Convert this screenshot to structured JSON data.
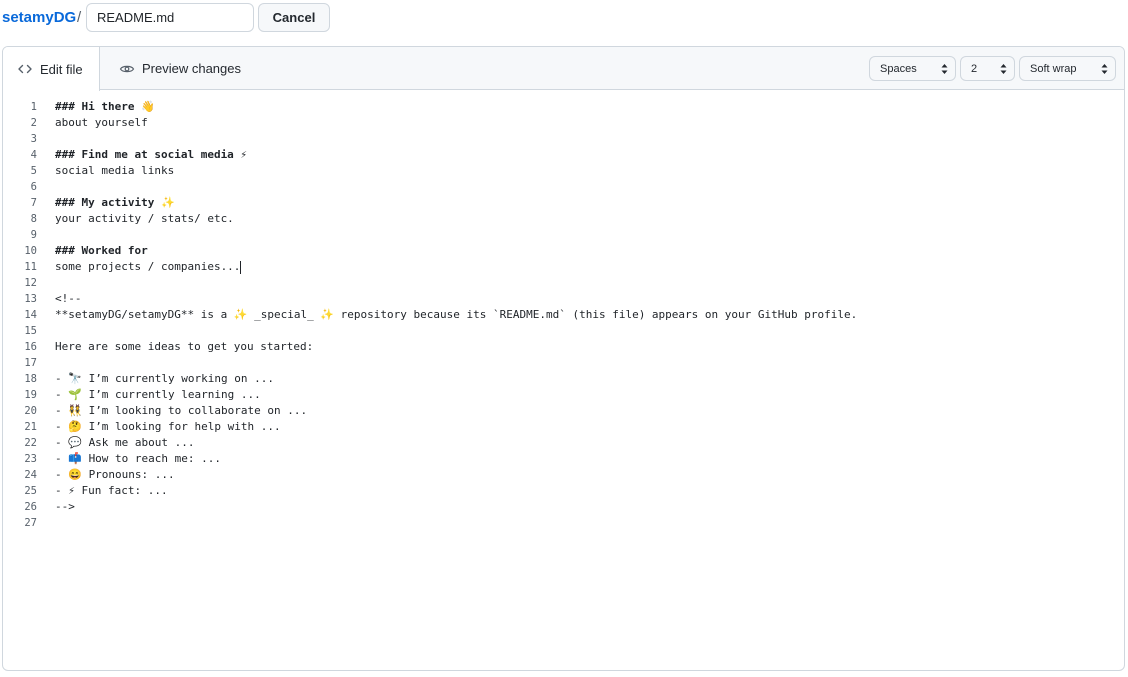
{
  "header": {
    "repo": "setamyDG",
    "separator": "/",
    "filename": "README.md",
    "cancel_label": "Cancel"
  },
  "tabs": {
    "edit": "Edit file",
    "preview": "Preview changes"
  },
  "options": {
    "indent_mode": "Spaces",
    "indent_size": "2",
    "wrap_mode": "Soft wrap"
  },
  "lines": [
    {
      "n": "1",
      "text": "### Hi there 👋"
    },
    {
      "n": "2",
      "text": "about yourself"
    },
    {
      "n": "3",
      "text": ""
    },
    {
      "n": "4",
      "text": "### Find me at social media ⚡"
    },
    {
      "n": "5",
      "text": "social media links"
    },
    {
      "n": "6",
      "text": ""
    },
    {
      "n": "7",
      "text": "### My activity ✨"
    },
    {
      "n": "8",
      "text": "your activity / stats/ etc."
    },
    {
      "n": "9",
      "text": ""
    },
    {
      "n": "10",
      "text": "### Worked for"
    },
    {
      "n": "11",
      "text": "some projects / companies..."
    },
    {
      "n": "12",
      "text": ""
    },
    {
      "n": "13",
      "text": "<!--"
    },
    {
      "n": "14",
      "text": "**setamyDG/setamyDG** is a ✨ _special_ ✨ repository because its `README.md` (this file) appears on your GitHub profile."
    },
    {
      "n": "15",
      "text": ""
    },
    {
      "n": "16",
      "text": "Here are some ideas to get you started:"
    },
    {
      "n": "17",
      "text": ""
    },
    {
      "n": "18",
      "text": "- 🔭 I’m currently working on ..."
    },
    {
      "n": "19",
      "text": "- 🌱 I’m currently learning ..."
    },
    {
      "n": "20",
      "text": "- 👯 I’m looking to collaborate on ..."
    },
    {
      "n": "21",
      "text": "- 🤔 I’m looking for help with ..."
    },
    {
      "n": "22",
      "text": "- 💬 Ask me about ..."
    },
    {
      "n": "23",
      "text": "- 📫 How to reach me: ..."
    },
    {
      "n": "24",
      "text": "- 😄 Pronouns: ..."
    },
    {
      "n": "25",
      "text": "- ⚡ Fun fact: ..."
    },
    {
      "n": "26",
      "text": "-->"
    },
    {
      "n": "27",
      "text": ""
    }
  ]
}
